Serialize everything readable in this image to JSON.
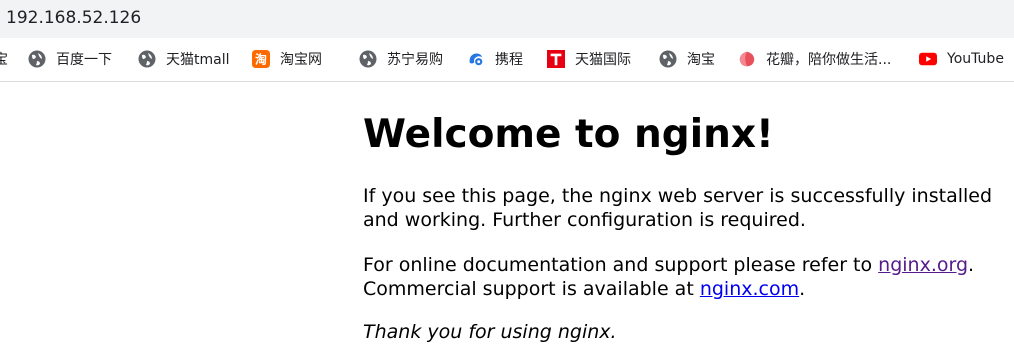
{
  "browser": {
    "url": "192.168.52.126"
  },
  "bookmarks": [
    {
      "label": "",
      "icon": "truncated-item"
    },
    {
      "label": "百度一下",
      "icon": "globe-icon"
    },
    {
      "label": "天猫tmall",
      "icon": "globe-icon"
    },
    {
      "label": "淘宝网",
      "icon": "taobao-icon"
    },
    {
      "label": "苏宁易购",
      "icon": "globe-icon"
    },
    {
      "label": "携程",
      "icon": "ctrip-icon"
    },
    {
      "label": "天猫国际",
      "icon": "tmall-global-icon"
    },
    {
      "label": "淘宝",
      "icon": "globe-icon"
    },
    {
      "label": "花瓣，陪你做生活...",
      "icon": "huaban-icon"
    },
    {
      "label": "YouTube",
      "icon": "youtube-icon"
    }
  ],
  "page": {
    "heading": "Welcome to nginx!",
    "para1": "If you see this page, the nginx web server is successfully installed and working. Further configuration is required.",
    "para2_text1": "For online documentation and support please refer to ",
    "para2_link1": "nginx.org",
    "para2_text2": ".",
    "para2_text3": "Commercial support is available at ",
    "para2_link2": "nginx.com",
    "para2_text4": ".",
    "para3": "Thank you for using nginx."
  },
  "colors": {
    "link": "#0000ee",
    "visited_link": "#551a8b",
    "address_bar_bg": "#f1f3f4"
  }
}
